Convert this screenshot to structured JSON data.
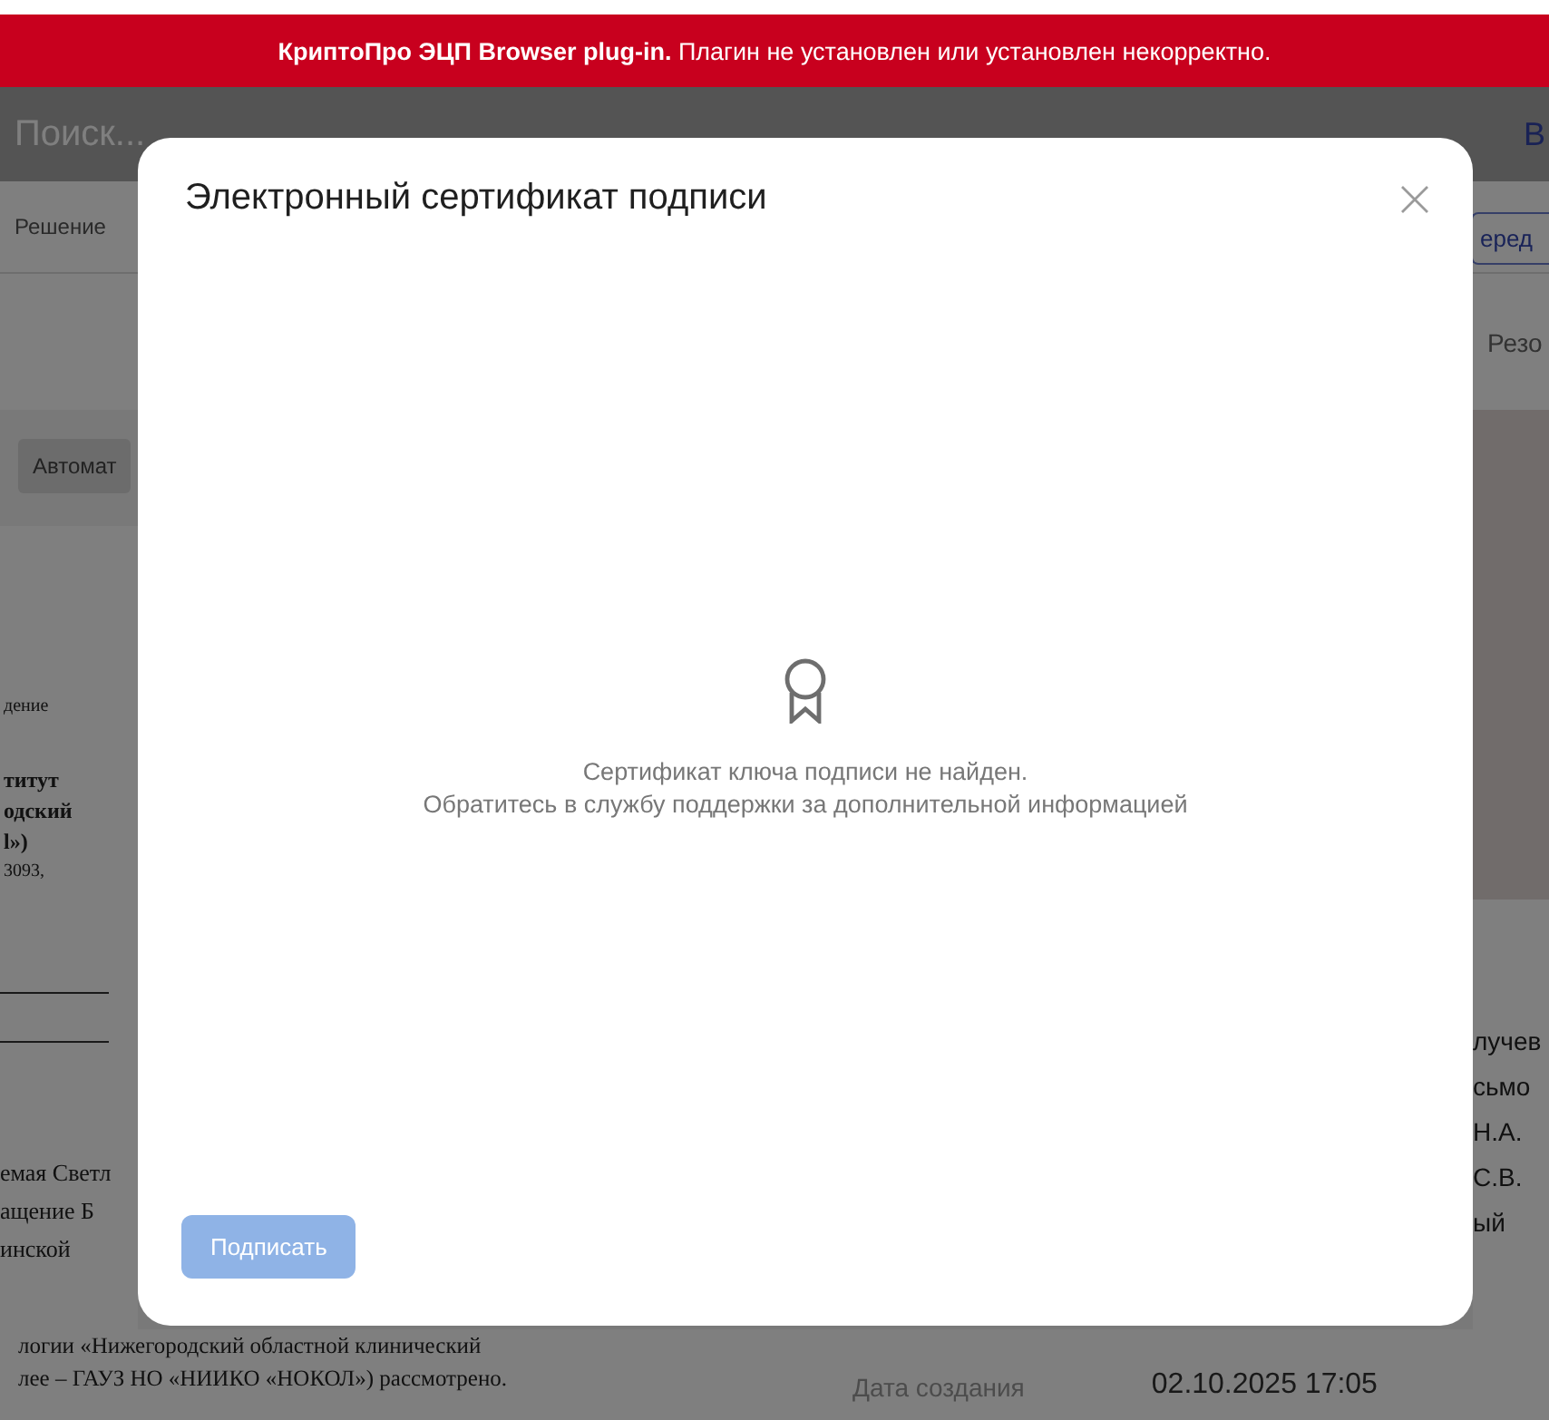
{
  "banner": {
    "text": "**КриптоПро ЭЦП Browser plug-in.** Плагин не установлен или установлен некорректно."
  },
  "background": {
    "search": {
      "placeholder": "Поиск..."
    },
    "top_right": "В",
    "tab": "Решение",
    "action_button": "еред",
    "column_header": "Резо",
    "tool_button": "Автомат",
    "document_fragments": [
      {
        "text": "дение",
        "bold": false
      },
      {
        "text": "титут",
        "bold": true
      },
      {
        "text": "одский",
        "bold": true
      },
      {
        "text": "l»)",
        "bold": true
      },
      {
        "text": "3093,",
        "bold": false
      }
    ],
    "document_greeting": [
      "емая Светл",
      "ащение Б",
      "инской"
    ],
    "document_lines": [
      "логии «Нижегородский областной клинический",
      "лее – ГАУЗ НО «НИИКО «НОКОЛ») рассмотрено."
    ],
    "side_fragments": [
      "лучев",
      "сьмо",
      "Н.А.",
      "С.В.",
      "ый"
    ],
    "meta": {
      "label": "Дата создания",
      "value": "02.10.2025 17:05"
    }
  },
  "dialog": {
    "title": "Электронный сертификат подписи",
    "message": [
      "Сертификат ключа подписи не найден.",
      "Обратитесь в службу поддержки за дополнительной информацией"
    ],
    "sign_button": {
      "label": "Подписать",
      "disabled": true
    }
  }
}
